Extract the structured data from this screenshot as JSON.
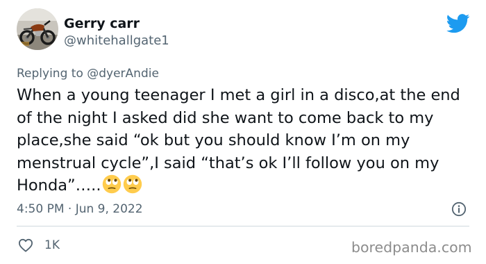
{
  "author": {
    "display_name": "Gerry carr",
    "handle": "@whitehallgate1",
    "avatar": "motorcycle-photo"
  },
  "reply": {
    "prefix": "Replying to ",
    "mention": "@dyerAndie"
  },
  "tweet": {
    "text": "When a young teenager I met a girl in a disco,at the end of the night I asked did she want to come back to my place,she said “ok but you should know I’m on my menstrual cycle”,I said “that’s ok I’ll follow you on my Honda”…..",
    "emojis": [
      "face-with-rolling-eyes",
      "face-with-rolling-eyes"
    ],
    "timestamp": "4:50 PM · Jun 9, 2022"
  },
  "stats": {
    "likes": "1K"
  },
  "icons": {
    "brand": "twitter-bird-icon",
    "info": "info-icon",
    "like": "heart-icon"
  },
  "colors": {
    "brand_blue": "#1d9bf0",
    "secondary_text": "#536471",
    "primary_text": "#0f1419",
    "divider": "#cfd9de"
  },
  "watermark": "boredpanda.com"
}
